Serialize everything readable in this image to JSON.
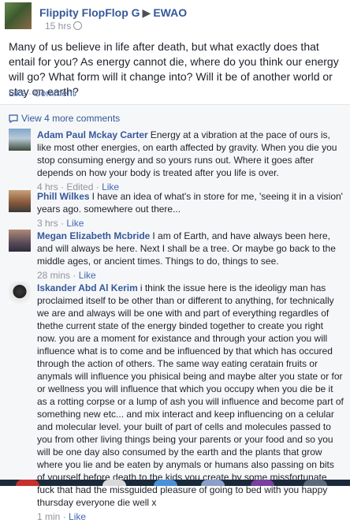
{
  "post": {
    "author": "Flippity FlopFlop G",
    "arrow": "▶",
    "group": "EWAO",
    "time": "15 hrs",
    "text": "Many of us believe in life after death, but what exactly does that entail for you? As energy cannot die, where do you think our energy will go? What form will it change into? Will it be of another world or stay on earth?",
    "like_label": "Like",
    "comment_label": "Comment",
    "separator": "·"
  },
  "comments_section": {
    "view_more": "View 4 more comments",
    "items": [
      {
        "name": "Adam Paul Mckay Carter",
        "text": "Energy at a vibration at the pace of ours is, like most other energies, on earth affected by gravity. When you die you stop consuming energy and so yours runs out. Where it goes after depends on how your body is treated after you life is over.",
        "time": "4 hrs",
        "edited": "Edited",
        "like": "Like"
      },
      {
        "name": "Phill Wilkes",
        "text": "I have an idea of what's in store for me, 'seeing it in a vision' years ago. somewhere out there...",
        "time": "3 hrs",
        "like": "Like"
      },
      {
        "name": "Megan Elizabeth Mcbride",
        "text": "I am of Earth, and have always been here, and will always be here. Next I shall be a tree. Or maybe go back to the middle ages, or ancient times. Things to do, things to see.",
        "time": "28 mins",
        "like": "Like"
      },
      {
        "name": "Iskander Abd Al Kerim",
        "text": "i think the issue here is the ideoligy man has proclaimed itself to be other than or different to anything, for technically we are and always will be one with and part of everything regardles of thethe current state of the energy binded together to create you right now. you are a moment for existance and through your action you will influence what is to come and be influenced by that which has occured through the action of others. The same way eating ceratain fruits or anymals will influence you phisical being and maybe alter you state or for or wellness you will influence that which you occupy when you die be it as a rotting corpse or a lump of ash you will influence and become part of something new etc... and mix interact and keep influencing on a celular and molecular level. your built of part of cells and molecules passed to you from other living things being your parents or your food and so you will be one day also consumed by the earth and the plants that grow where you lie and be eaten by anymals or humans also passing on bits of yourself before death to the kids you create by some missfortunate fuck that had the missguided pleasure of going to bed with you happy thursday everyone die well x",
        "time": "1 min",
        "like": "Like"
      }
    ]
  },
  "colors": {
    "link": "#365899",
    "action": "#4267b2",
    "meta": "#90949c",
    "comments_bg": "#f6f7f9"
  },
  "icons": [
    "globe-icon",
    "comment-bubble-icon"
  ]
}
